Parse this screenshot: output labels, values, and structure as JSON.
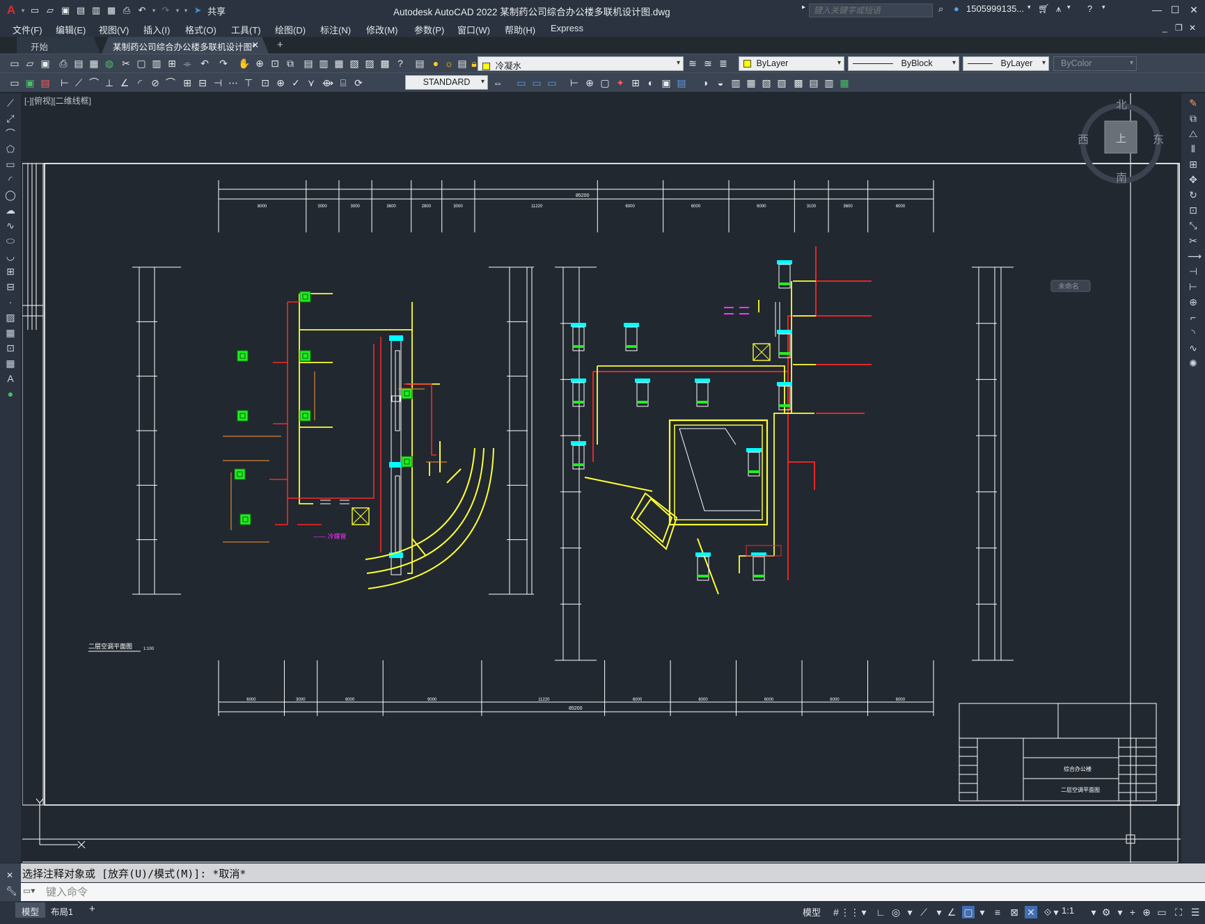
{
  "titlebar": {
    "app_title": "Autodesk AutoCAD 2022    某制药公司综合办公楼多联机设计图.dwg",
    "share_label": "共享",
    "search_placeholder": "键入关键字或短语",
    "user_label": "1505999135...",
    "colors": {
      "app_logo": "#e22b2b",
      "share_accent": "#3c8fe0"
    }
  },
  "menu": [
    "文件(F)",
    "编辑(E)",
    "视图(V)",
    "插入(I)",
    "格式(O)",
    "工具(T)",
    "绘图(D)",
    "标注(N)",
    "修改(M)",
    "参数(P)",
    "窗口(W)",
    "帮助(H)",
    "Express"
  ],
  "tabs": {
    "start": "开始",
    "drawing": "某制药公司综合办公楼多联机设计图*"
  },
  "properties": {
    "layer": "冷凝水",
    "layer_color": "#ffff00",
    "color": "ByLayer",
    "linetype": "ByBlock",
    "lineweight": "ByLayer",
    "plotstyle": "ByColor",
    "text_style": "STANDARD"
  },
  "viewport": {
    "label": "[-][俯视][二维线框]"
  },
  "viewcube": {
    "north": "北",
    "south": "南",
    "east": "东",
    "west": "西",
    "face": "上",
    "wcs": "未命名"
  },
  "drawing": {
    "left_plan_title": "二层空调平面图",
    "left_plan_scale": "1:100",
    "titleblock_project": "综合办公楼",
    "titleblock_sheet": "二层空调平面图",
    "legend_text": "—— 冷媒管",
    "top_total_dim": "85200",
    "bottom_total_dim": "85200",
    "top_dims": [
      "8000",
      "3000",
      "3000",
      "3600",
      "2800",
      "3000",
      "11220",
      "6000",
      "6000",
      "6000",
      "3100",
      "3600",
      "6000"
    ],
    "bottom_dims": [
      "6000",
      "3000",
      "6000",
      "9000",
      "11220",
      "6000",
      "6000",
      "6000",
      "6000",
      "6000"
    ]
  },
  "command": {
    "history": "选择注释对象或 [放弃(U)/模式(M)]: *取消*",
    "placeholder": "键入命令"
  },
  "statusbar": {
    "layouts": [
      "模型",
      "布局1"
    ],
    "model_label": "模型",
    "scale": "1:1"
  }
}
